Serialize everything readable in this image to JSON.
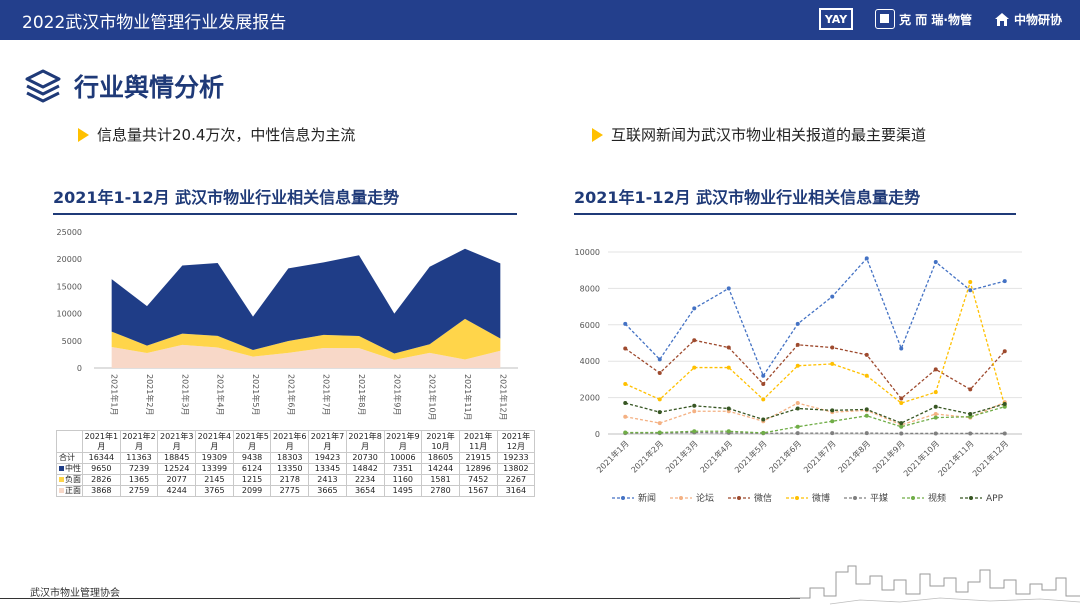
{
  "header": {
    "title": "2022武汉市物业管理行业发展报告",
    "logo1": "YAY",
    "logo2": "克 而 瑞·物管",
    "logo3": "中物研协"
  },
  "section": {
    "title": "行业舆情分析",
    "bullet_left": "信息量共计20.4万次，中性信息为主流",
    "bullet_right": "互联网新闻为武汉市物业相关报道的最主要渠道"
  },
  "footer": {
    "org": "武汉市物业管理协会"
  },
  "colors": {
    "navy": "#1f3a78",
    "header_bg": "#233f8c",
    "neutral": "#1f3d87",
    "negative": "#ffd54a",
    "positive": "#f8d8c8",
    "accent": "#ffc000"
  },
  "chart_data": [
    {
      "type": "area",
      "title": "2021年1-12月 武汉市物业行业相关信息量走势",
      "categories": [
        "2021年1月",
        "2021年2月",
        "2021年3月",
        "2021年4月",
        "2021年5月",
        "2021年6月",
        "2021年7月",
        "2021年8月",
        "2021年9月",
        "2021年10月",
        "2021年11月",
        "2021年12月"
      ],
      "ylim": [
        0,
        25000
      ],
      "yticks": [
        "0",
        "5000",
        "10000",
        "15000",
        "20000",
        "25000"
      ],
      "stacked": true,
      "grid": false,
      "total_label": "合计",
      "total": [
        16344,
        11363,
        18845,
        19309,
        9438,
        18303,
        19423,
        20730,
        10006,
        18605,
        21915,
        19233
      ],
      "series": [
        {
          "name": "中性",
          "color": "#1f3d87",
          "values": [
            9650,
            7239,
            12524,
            13399,
            6124,
            13350,
            13345,
            14842,
            7351,
            14244,
            12896,
            13802
          ]
        },
        {
          "name": "负面",
          "color": "#ffd54a",
          "values": [
            2826,
            1365,
            2077,
            2145,
            1215,
            2178,
            2413,
            2234,
            1160,
            1581,
            7452,
            2267
          ]
        },
        {
          "name": "正面",
          "color": "#f8d8c8",
          "values": [
            3868,
            2759,
            4244,
            3765,
            2099,
            2775,
            3665,
            3654,
            1495,
            2780,
            1567,
            3164
          ]
        }
      ]
    },
    {
      "type": "line",
      "title": "2021年1-12月 武汉市物业行业相关信息量走势",
      "categories": [
        "2021年1月",
        "2021年2月",
        "2021年3月",
        "2021年4月",
        "2021年5月",
        "2021年6月",
        "2021年7月",
        "2021年8月",
        "2021年9月",
        "2021年10月",
        "2021年11月",
        "2021年12月"
      ],
      "ylim": [
        0,
        10000
      ],
      "yticks": [
        "0",
        "2000",
        "4000",
        "6000",
        "8000",
        "10000"
      ],
      "grid": true,
      "legend_position": "bottom",
      "series": [
        {
          "name": "新闻",
          "color": "#4472c4",
          "values": [
            6050,
            4100,
            6900,
            8000,
            3200,
            6050,
            7550,
            9650,
            4700,
            9450,
            7900,
            8400
          ]
        },
        {
          "name": "论坛",
          "color": "#f4b183",
          "values": [
            950,
            600,
            1250,
            1250,
            700,
            1700,
            1200,
            1300,
            500,
            1100,
            900,
            1750
          ]
        },
        {
          "name": "微信",
          "color": "#9e4a2e",
          "values": [
            4700,
            3350,
            5150,
            4750,
            2750,
            4900,
            4750,
            4350,
            1950,
            3550,
            2450,
            4550
          ]
        },
        {
          "name": "微博",
          "color": "#ffc000",
          "values": [
            2750,
            1900,
            3650,
            3650,
            1900,
            3750,
            3850,
            3200,
            1700,
            2300,
            8350,
            1550
          ]
        },
        {
          "name": "平媒",
          "color": "#7f7f7f",
          "values": [
            50,
            50,
            80,
            60,
            40,
            50,
            50,
            50,
            30,
            30,
            30,
            30
          ]
        },
        {
          "name": "视频",
          "color": "#70ad47",
          "values": [
            80,
            80,
            150,
            150,
            60,
            400,
            700,
            1000,
            400,
            900,
            950,
            1500
          ]
        },
        {
          "name": "APP",
          "color": "#375623",
          "values": [
            1700,
            1200,
            1550,
            1400,
            800,
            1400,
            1300,
            1350,
            600,
            1500,
            1100,
            1650
          ]
        }
      ]
    }
  ]
}
